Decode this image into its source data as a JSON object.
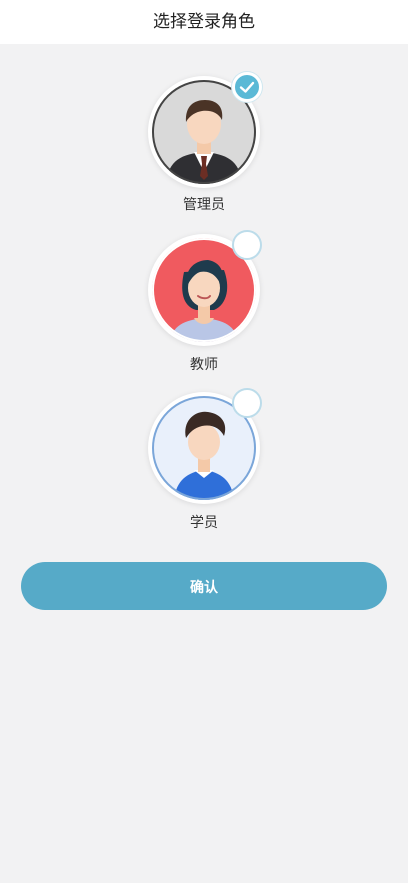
{
  "header": {
    "title": "选择登录角色"
  },
  "roles": [
    {
      "label": "管理员",
      "selected": true,
      "avatar": "admin-avatar"
    },
    {
      "label": "教师",
      "selected": false,
      "avatar": "teacher-avatar"
    },
    {
      "label": "学员",
      "selected": false,
      "avatar": "student-avatar"
    }
  ],
  "actions": {
    "confirm_label": "确认"
  },
  "colors": {
    "accent": "#56aac8",
    "check_selected": "#5ab9d6",
    "background": "#f2f2f3"
  }
}
